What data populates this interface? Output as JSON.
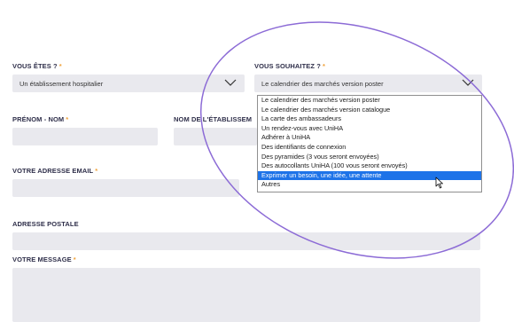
{
  "form": {
    "vous_etes": {
      "label": "VOUS ÊTES ?",
      "required": "*",
      "value": "Un établissement hospitalier"
    },
    "vous_souhaitez": {
      "label": "VOUS SOUHAITEZ ?",
      "required": "*",
      "value": "Le calendrier des marchés version poster",
      "options": [
        "Le calendrier des marchés version poster",
        "Le calendrier des marchés version catalogue",
        "La carte des ambassadeurs",
        "Un rendez-vous avec UniHA",
        "Adhérer à UniHA",
        "Des identifiants de connexion",
        "Des pyramides (3 vous seront envoyées)",
        "Des autocollants UniHA (100 vous seront envoyés)",
        "Exprimer un besoin, une idée, une attente",
        "Autres"
      ],
      "highlighted_index": 8
    },
    "prenom_nom": {
      "label": "PRÉNOM - NOM",
      "required": "*"
    },
    "etablissement": {
      "label": "NOM DE L'ÉTABLISSEM"
    },
    "email": {
      "label": "VOTRE ADRESSE EMAIL",
      "required": "*"
    },
    "adresse": {
      "label": "ADRESSE POSTALE"
    },
    "message": {
      "label": "VOTRE MESSAGE",
      "required": "*"
    }
  },
  "colors": {
    "accent_required": "#f0a23a",
    "highlight": "#1e73e8",
    "field_bg": "#e9e9ee",
    "annotation_ellipse": "#8c6bd6"
  },
  "icons": {
    "select_arrow": "chevron-down-icon",
    "cursor": "mouse-pointer-icon"
  }
}
